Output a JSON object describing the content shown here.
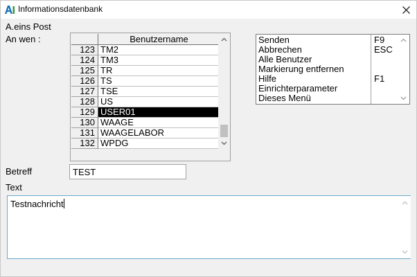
{
  "window": {
    "title": "Informationsdatenbank"
  },
  "labels": {
    "folder": "A.eins Post",
    "recipient": "An wen :",
    "subject": "Betreff",
    "text": "Text"
  },
  "user_grid": {
    "column_header": "Benutzername",
    "rows": [
      {
        "num": "123",
        "name": "TM2",
        "selected": false
      },
      {
        "num": "124",
        "name": "TM3",
        "selected": false
      },
      {
        "num": "125",
        "name": "TR",
        "selected": false
      },
      {
        "num": "126",
        "name": "TS",
        "selected": false
      },
      {
        "num": "127",
        "name": "TSE",
        "selected": false
      },
      {
        "num": "128",
        "name": "US",
        "selected": false
      },
      {
        "num": "129",
        "name": "USER01",
        "selected": true
      },
      {
        "num": "130",
        "name": "WAAGE",
        "selected": false
      },
      {
        "num": "131",
        "name": "WAAGELABOR",
        "selected": false
      },
      {
        "num": "132",
        "name": "WPDG",
        "selected": false
      }
    ]
  },
  "menu": {
    "items": [
      {
        "label": "Senden",
        "key": "F9"
      },
      {
        "label": "Abbrechen",
        "key": "ESC"
      },
      {
        "label": "Alle Benutzer",
        "key": ""
      },
      {
        "label": "Markierung entfernen",
        "key": ""
      },
      {
        "label": "Hilfe",
        "key": "F1"
      },
      {
        "label": "Einrichterparameter",
        "key": ""
      },
      {
        "label": "Dieses Menü",
        "key": ""
      }
    ]
  },
  "form": {
    "subject_value": "TEST",
    "text_value": "Testnachricht"
  },
  "colors": {
    "selection_bg": "#000000",
    "selection_fg": "#ffffff",
    "textarea_border": "#6aa9c9"
  }
}
